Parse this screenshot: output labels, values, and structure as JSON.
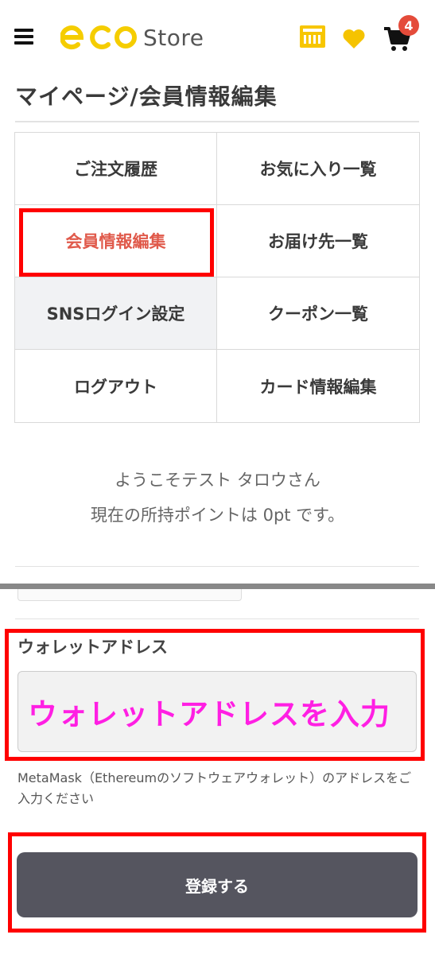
{
  "header": {
    "logo_text": "Store",
    "cart_count": "4",
    "icons": [
      "menu-icon",
      "store-logo",
      "point-card-icon",
      "heart-icon",
      "cart-icon"
    ],
    "brand_color": "#f5cd00"
  },
  "page": {
    "title": "マイページ/会員情報編集"
  },
  "menu": {
    "items": [
      {
        "label": "ご注文履歴"
      },
      {
        "label": "お気に入り一覧"
      },
      {
        "label": "会員情報編集"
      },
      {
        "label": "お届け先一覧"
      },
      {
        "label": "SNSログイン設定"
      },
      {
        "label": "クーポン一覧"
      },
      {
        "label": "ログアウト"
      },
      {
        "label": "カード情報編集"
      }
    ],
    "active_index": 2,
    "active_color": "#e05a4b"
  },
  "welcome": {
    "line1": "ようこそテスト タロウさん",
    "line2": "現在の所持ポイントは 0pt です。"
  },
  "wallet": {
    "label": "ウォレットアドレス",
    "placeholder": "ウォレットアドレスを入力",
    "hint": "MetaMask（Ethereumのソフトウェアウォレット）のアドレスをご入力ください"
  },
  "submit": {
    "label": "登録する"
  },
  "annotation_color": "#ff0000"
}
